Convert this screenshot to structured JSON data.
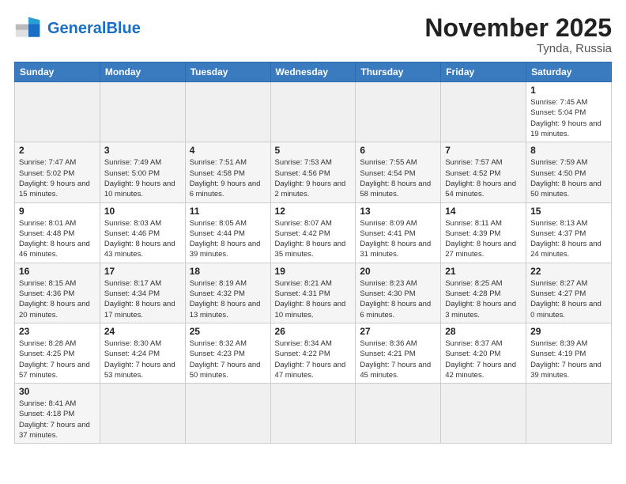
{
  "header": {
    "logo_general": "General",
    "logo_blue": "Blue",
    "month_year": "November 2025",
    "location": "Tynda, Russia"
  },
  "weekdays": [
    "Sunday",
    "Monday",
    "Tuesday",
    "Wednesday",
    "Thursday",
    "Friday",
    "Saturday"
  ],
  "weeks": [
    [
      {
        "day": "",
        "info": ""
      },
      {
        "day": "",
        "info": ""
      },
      {
        "day": "",
        "info": ""
      },
      {
        "day": "",
        "info": ""
      },
      {
        "day": "",
        "info": ""
      },
      {
        "day": "",
        "info": ""
      },
      {
        "day": "1",
        "info": "Sunrise: 7:45 AM\nSunset: 5:04 PM\nDaylight: 9 hours\nand 19 minutes."
      }
    ],
    [
      {
        "day": "2",
        "info": "Sunrise: 7:47 AM\nSunset: 5:02 PM\nDaylight: 9 hours\nand 15 minutes."
      },
      {
        "day": "3",
        "info": "Sunrise: 7:49 AM\nSunset: 5:00 PM\nDaylight: 9 hours\nand 10 minutes."
      },
      {
        "day": "4",
        "info": "Sunrise: 7:51 AM\nSunset: 4:58 PM\nDaylight: 9 hours\nand 6 minutes."
      },
      {
        "day": "5",
        "info": "Sunrise: 7:53 AM\nSunset: 4:56 PM\nDaylight: 9 hours\nand 2 minutes."
      },
      {
        "day": "6",
        "info": "Sunrise: 7:55 AM\nSunset: 4:54 PM\nDaylight: 8 hours\nand 58 minutes."
      },
      {
        "day": "7",
        "info": "Sunrise: 7:57 AM\nSunset: 4:52 PM\nDaylight: 8 hours\nand 54 minutes."
      },
      {
        "day": "8",
        "info": "Sunrise: 7:59 AM\nSunset: 4:50 PM\nDaylight: 8 hours\nand 50 minutes."
      }
    ],
    [
      {
        "day": "9",
        "info": "Sunrise: 8:01 AM\nSunset: 4:48 PM\nDaylight: 8 hours\nand 46 minutes."
      },
      {
        "day": "10",
        "info": "Sunrise: 8:03 AM\nSunset: 4:46 PM\nDaylight: 8 hours\nand 43 minutes."
      },
      {
        "day": "11",
        "info": "Sunrise: 8:05 AM\nSunset: 4:44 PM\nDaylight: 8 hours\nand 39 minutes."
      },
      {
        "day": "12",
        "info": "Sunrise: 8:07 AM\nSunset: 4:42 PM\nDaylight: 8 hours\nand 35 minutes."
      },
      {
        "day": "13",
        "info": "Sunrise: 8:09 AM\nSunset: 4:41 PM\nDaylight: 8 hours\nand 31 minutes."
      },
      {
        "day": "14",
        "info": "Sunrise: 8:11 AM\nSunset: 4:39 PM\nDaylight: 8 hours\nand 27 minutes."
      },
      {
        "day": "15",
        "info": "Sunrise: 8:13 AM\nSunset: 4:37 PM\nDaylight: 8 hours\nand 24 minutes."
      }
    ],
    [
      {
        "day": "16",
        "info": "Sunrise: 8:15 AM\nSunset: 4:36 PM\nDaylight: 8 hours\nand 20 minutes."
      },
      {
        "day": "17",
        "info": "Sunrise: 8:17 AM\nSunset: 4:34 PM\nDaylight: 8 hours\nand 17 minutes."
      },
      {
        "day": "18",
        "info": "Sunrise: 8:19 AM\nSunset: 4:32 PM\nDaylight: 8 hours\nand 13 minutes."
      },
      {
        "day": "19",
        "info": "Sunrise: 8:21 AM\nSunset: 4:31 PM\nDaylight: 8 hours\nand 10 minutes."
      },
      {
        "day": "20",
        "info": "Sunrise: 8:23 AM\nSunset: 4:30 PM\nDaylight: 8 hours\nand 6 minutes."
      },
      {
        "day": "21",
        "info": "Sunrise: 8:25 AM\nSunset: 4:28 PM\nDaylight: 8 hours\nand 3 minutes."
      },
      {
        "day": "22",
        "info": "Sunrise: 8:27 AM\nSunset: 4:27 PM\nDaylight: 8 hours\nand 0 minutes."
      }
    ],
    [
      {
        "day": "23",
        "info": "Sunrise: 8:28 AM\nSunset: 4:25 PM\nDaylight: 7 hours\nand 57 minutes."
      },
      {
        "day": "24",
        "info": "Sunrise: 8:30 AM\nSunset: 4:24 PM\nDaylight: 7 hours\nand 53 minutes."
      },
      {
        "day": "25",
        "info": "Sunrise: 8:32 AM\nSunset: 4:23 PM\nDaylight: 7 hours\nand 50 minutes."
      },
      {
        "day": "26",
        "info": "Sunrise: 8:34 AM\nSunset: 4:22 PM\nDaylight: 7 hours\nand 47 minutes."
      },
      {
        "day": "27",
        "info": "Sunrise: 8:36 AM\nSunset: 4:21 PM\nDaylight: 7 hours\nand 45 minutes."
      },
      {
        "day": "28",
        "info": "Sunrise: 8:37 AM\nSunset: 4:20 PM\nDaylight: 7 hours\nand 42 minutes."
      },
      {
        "day": "29",
        "info": "Sunrise: 8:39 AM\nSunset: 4:19 PM\nDaylight: 7 hours\nand 39 minutes."
      }
    ],
    [
      {
        "day": "30",
        "info": "Sunrise: 8:41 AM\nSunset: 4:18 PM\nDaylight: 7 hours\nand 37 minutes."
      },
      {
        "day": "",
        "info": ""
      },
      {
        "day": "",
        "info": ""
      },
      {
        "day": "",
        "info": ""
      },
      {
        "day": "",
        "info": ""
      },
      {
        "day": "",
        "info": ""
      },
      {
        "day": "",
        "info": ""
      }
    ]
  ]
}
